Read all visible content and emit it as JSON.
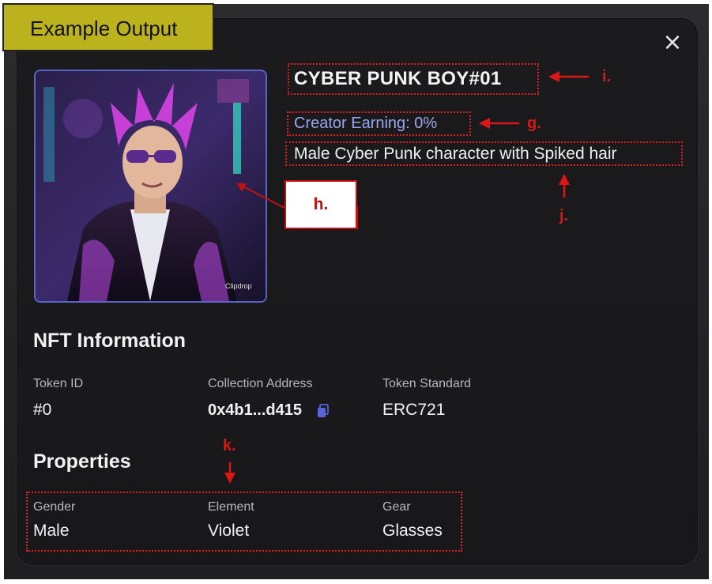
{
  "tag": "Example Output",
  "nft": {
    "title": "CYBER PUNK BOY#01",
    "creator_earning": "Creator Earning: 0%",
    "description": "Male Cyber Punk character with Spiked hair",
    "image_watermark": "Clipdrop"
  },
  "info": {
    "heading": "NFT Information",
    "token_id_label": "Token ID",
    "token_id": "#0",
    "collection_label": "Collection Address",
    "collection_address": "0x4b1...d415",
    "standard_label": "Token Standard",
    "standard": "ERC721"
  },
  "properties": {
    "heading": "Properties",
    "items": [
      {
        "label": "Gender",
        "value": "Male"
      },
      {
        "label": "Element",
        "value": "Violet"
      },
      {
        "label": "Gear",
        "value": "Glasses"
      }
    ]
  },
  "annotations": {
    "g": "g.",
    "h": "h.",
    "i": "i.",
    "j": "j.",
    "k": "k."
  },
  "icons": {
    "close": "close-icon",
    "copy": "copy-icon"
  },
  "colors": {
    "accent_blue": "#9aa6ee",
    "annotation_red": "#e01515",
    "tag_yellow": "#bbb21e"
  }
}
